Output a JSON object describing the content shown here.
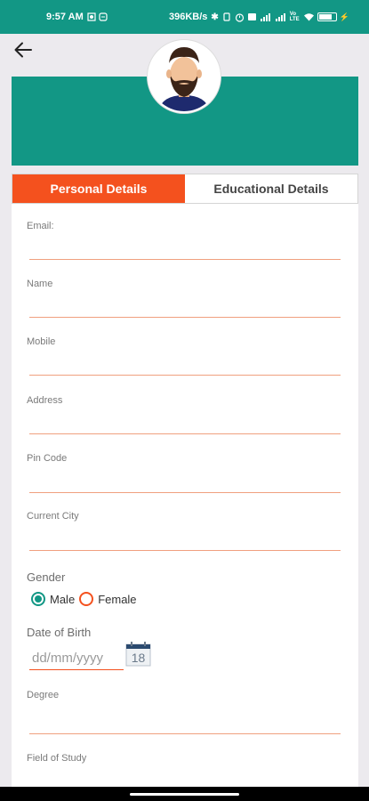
{
  "status_bar": {
    "time": "9:57 AM",
    "network_speed": "396KB/s",
    "battery_icon": "battery-icon",
    "carrier": "Vo LTE"
  },
  "header": {
    "back_icon": "arrow-left-icon",
    "banner_color": "#129785",
    "avatar_icon": "bearded-man-avatar"
  },
  "tabs": [
    {
      "label": "Personal Details",
      "active": true
    },
    {
      "label": "Educational Details",
      "active": false
    }
  ],
  "form": {
    "email_label": "Email:",
    "name_label": "Name",
    "mobile_label": "Mobile",
    "address_label": "Address",
    "pincode_label": "Pin Code",
    "city_label": "Current City",
    "gender_label": "Gender",
    "gender_options": [
      "Male",
      "Female"
    ],
    "gender_selected": "Male",
    "dob_label": "Date of Birth",
    "dob_placeholder": "dd/mm/yyyy",
    "calendar_day": "18",
    "degree_label": "Degree",
    "field_of_study_label": "Field of Study"
  },
  "colors": {
    "primary": "#129785",
    "accent": "#f4511e",
    "underline": "#f0a07f"
  }
}
